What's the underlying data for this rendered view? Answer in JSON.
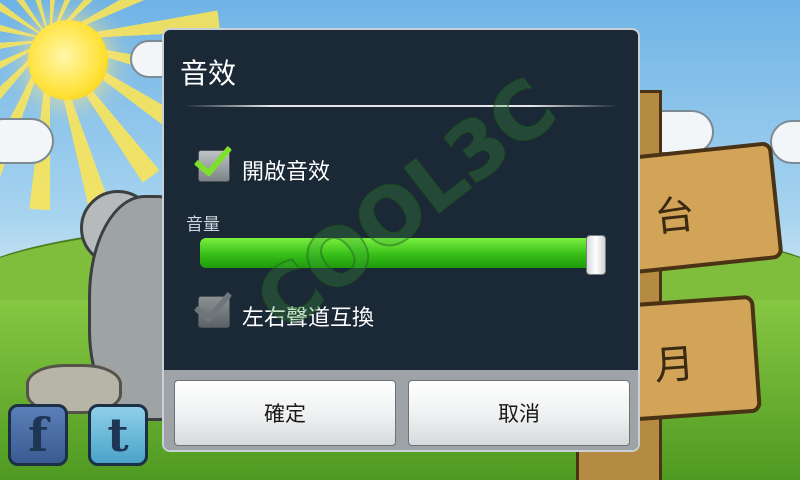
{
  "background": {
    "sign_text_top": "台",
    "sign_text_bottom": "月",
    "social": [
      {
        "name": "facebook-icon",
        "glyph": "f"
      },
      {
        "name": "twitter-icon",
        "glyph": "t"
      }
    ]
  },
  "dialog": {
    "title": "音效",
    "enable_sound": {
      "label": "開啟音效",
      "checked": true
    },
    "volume": {
      "label": "音量",
      "level": 0.98
    },
    "swap_channels": {
      "label": "左右聲道互換",
      "checked": false,
      "enabled": false
    },
    "buttons": {
      "ok": "確定",
      "cancel": "取消"
    }
  },
  "watermark": "COOL3C",
  "colors": {
    "dialog_bg": "#1b2836",
    "accent_green": "#37bf18",
    "check_green": "#7ee02b"
  }
}
